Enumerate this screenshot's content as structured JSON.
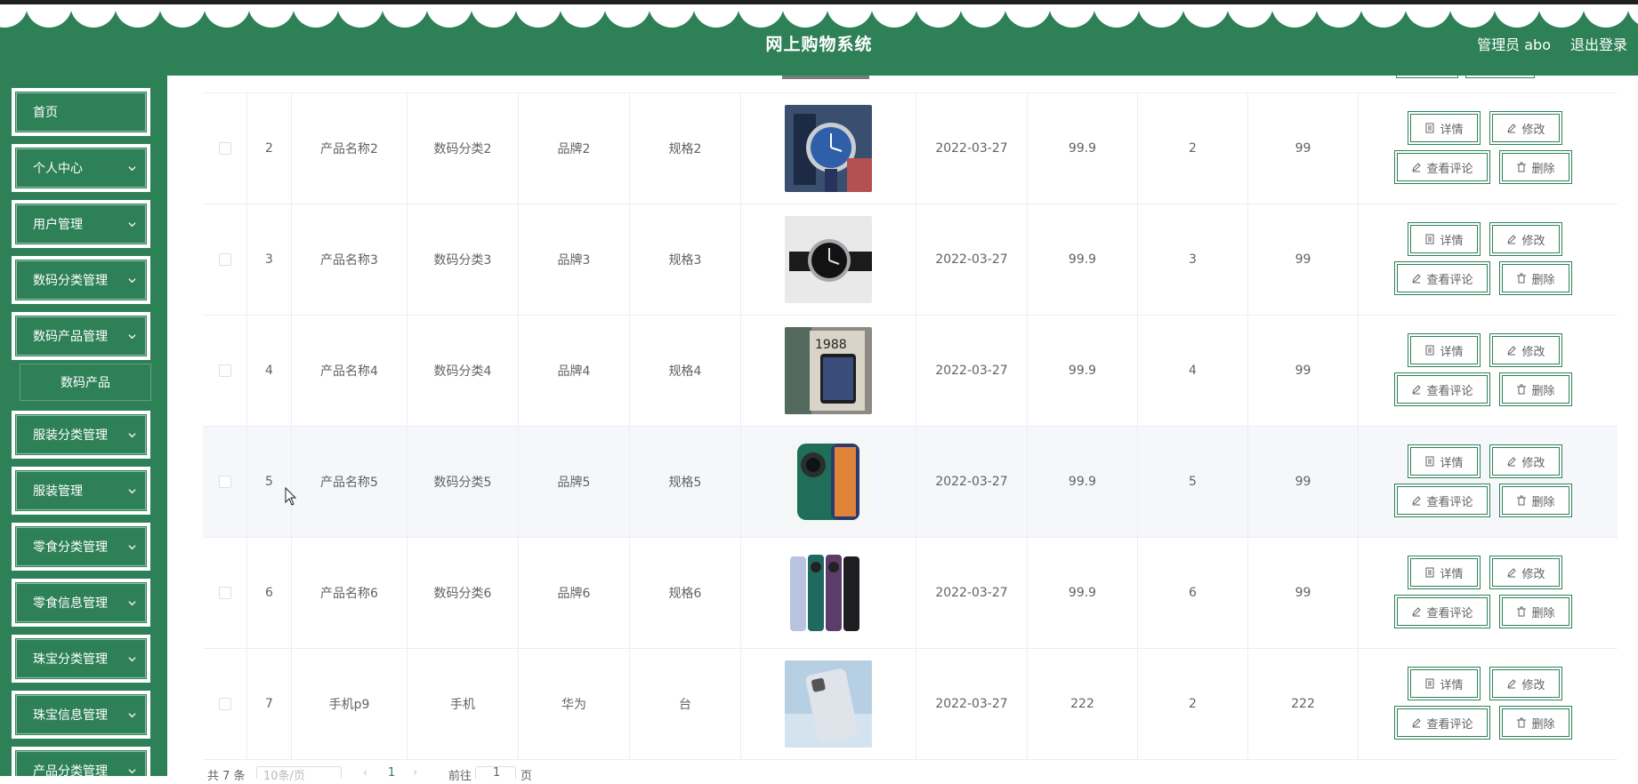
{
  "header": {
    "title": "网上购物系统",
    "user": "管理员 abo",
    "logout": "退出登录"
  },
  "sidebar": {
    "items": [
      {
        "label": "首页",
        "expandable": false
      },
      {
        "label": "个人中心",
        "expandable": true
      },
      {
        "label": "用户管理",
        "expandable": true
      },
      {
        "label": "数码分类管理",
        "expandable": true
      },
      {
        "label": "数码产品管理",
        "expandable": true
      },
      {
        "label": "服装分类管理",
        "expandable": true
      },
      {
        "label": "服装管理",
        "expandable": true
      },
      {
        "label": "零食分类管理",
        "expandable": true
      },
      {
        "label": "零食信息管理",
        "expandable": true
      },
      {
        "label": "珠宝分类管理",
        "expandable": true
      },
      {
        "label": "珠宝信息管理",
        "expandable": true
      },
      {
        "label": "产品分类管理",
        "expandable": true
      }
    ],
    "submenu": {
      "label": "数码产品"
    }
  },
  "table": {
    "rows": [
      {
        "index": "2",
        "name": "产品名称2",
        "category": "数码分类2",
        "brand": "品牌2",
        "spec": "规格2",
        "image": "blue-watch",
        "date": "2022-03-27",
        "price": "99.9",
        "col8": "2",
        "col9": "99"
      },
      {
        "index": "3",
        "name": "产品名称3",
        "category": "数码分类3",
        "brand": "品牌3",
        "spec": "规格3",
        "image": "black-watch",
        "date": "2022-03-27",
        "price": "99.9",
        "col8": "3",
        "col9": "99"
      },
      {
        "index": "4",
        "name": "产品名称4",
        "category": "数码分类4",
        "brand": "品牌4",
        "spec": "规格4",
        "image": "phone-box",
        "date": "2022-03-27",
        "price": "99.9",
        "col8": "4",
        "col9": "99"
      },
      {
        "index": "5",
        "name": "产品名称5",
        "category": "数码分类5",
        "brand": "品牌5",
        "spec": "规格5",
        "image": "green-phone",
        "date": "2022-03-27",
        "price": "99.9",
        "col8": "5",
        "col9": "99"
      },
      {
        "index": "6",
        "name": "产品名称6",
        "category": "数码分类6",
        "brand": "品牌6",
        "spec": "规格6",
        "image": "phone-lineup",
        "date": "2022-03-27",
        "price": "99.9",
        "col8": "6",
        "col9": "99"
      },
      {
        "index": "7",
        "name": "手机p9",
        "category": "手机",
        "brand": "华为",
        "spec": "台",
        "image": "silver-phone",
        "date": "2022-03-27",
        "price": "222",
        "col8": "2",
        "col9": "222"
      }
    ],
    "actions": {
      "detail": "详情",
      "edit": "修改",
      "comments": "查看评论",
      "delete": "删除"
    }
  },
  "pagination": {
    "total": "共 7 条",
    "page_size": "10条/页",
    "current": "1",
    "goto_prefix": "前往",
    "goto_value": "1",
    "goto_suffix": "页"
  },
  "colors": {
    "primary": "#2e8157",
    "border": "#ebeef5",
    "text": "#606266"
  }
}
